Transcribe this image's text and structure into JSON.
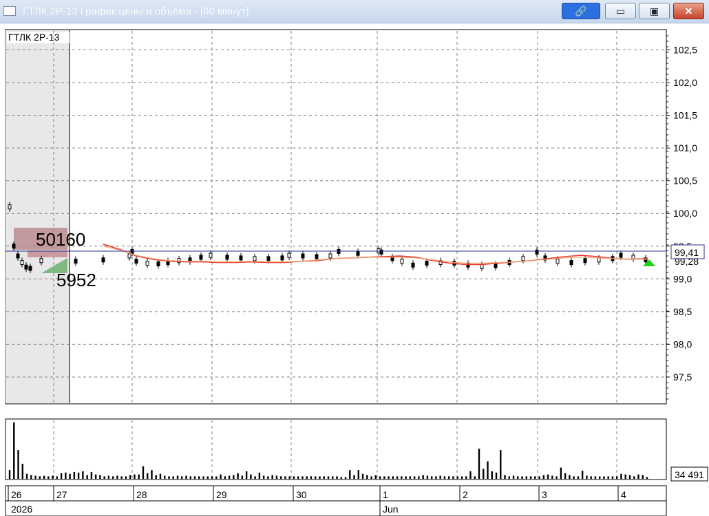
{
  "window": {
    "title": "ГТЛК 2Р-13 График цены и объёма - [60 минут]",
    "buttons": {
      "link": "🔗",
      "minimize": "▭",
      "maximize": "▣",
      "close": "✕"
    }
  },
  "chart": {
    "instrument": "ГТЛК 2Р-13",
    "big_labels": {
      "upper": "50160",
      "lower": "5952"
    }
  },
  "chart_data": [
    {
      "type": "line",
      "title": "ГТЛК 2Р-13",
      "y_ticks": [
        "102,5",
        "102,0",
        "101,5",
        "101,0",
        "100,5",
        "100,0",
        "99,5",
        "99,0",
        "98,5",
        "98,0",
        "97,5"
      ],
      "ylim": [
        97.1,
        102.8
      ],
      "last_price": "99,41",
      "prev_price": "99,28",
      "grid": true,
      "x_labels": [
        "26",
        "27",
        "28",
        "29",
        "30",
        "1",
        "2",
        "3",
        "4"
      ],
      "year_label": "2026",
      "month_label": "Jun",
      "series": [
        {
          "values": [
            99.53,
            99.45,
            99.35,
            99.3,
            99.27,
            99.26,
            99.26,
            99.25,
            99.25,
            99.26,
            99.25,
            99.25,
            99.27,
            99.28,
            99.31,
            99.32,
            99.33,
            99.34,
            99.35,
            99.33,
            99.28,
            99.24,
            99.22,
            99.22,
            99.24,
            99.26,
            99.28,
            99.31,
            99.34,
            99.36,
            99.34,
            99.31,
            99.3,
            99.31
          ]
        },
        {
          "values": [
            99.5,
            99.44,
            99.36,
            99.31,
            99.28,
            99.27,
            99.27,
            99.26,
            99.26,
            99.27,
            99.26,
            99.26,
            99.27,
            99.29,
            99.31,
            99.32,
            99.33,
            99.33,
            99.33,
            99.32,
            99.29,
            99.26,
            99.24,
            99.24,
            99.25,
            99.26,
            99.28,
            99.3,
            99.32,
            99.33,
            99.32,
            99.31,
            99.3,
            99.3
          ]
        }
      ]
    },
    {
      "type": "bar",
      "title": "",
      "last_volume": "34 491",
      "values": [
        14,
        90,
        46,
        24,
        8,
        6,
        5,
        4,
        5,
        4,
        5,
        4,
        9,
        10,
        8,
        11,
        10,
        12,
        6,
        11,
        7,
        6,
        4,
        5,
        4,
        5,
        4,
        4,
        6,
        7,
        7,
        20,
        9,
        14,
        6,
        8,
        5,
        4,
        4,
        5,
        4,
        5,
        4,
        4,
        4,
        4,
        4,
        4,
        4,
        7,
        4,
        5,
        6,
        9,
        5,
        12,
        7,
        4,
        10,
        5,
        4,
        6,
        5,
        4,
        4,
        4,
        4,
        4,
        4,
        4,
        4,
        4,
        4,
        4,
        4,
        4,
        4,
        3,
        3,
        14,
        6,
        14,
        8,
        6,
        4,
        6,
        4,
        4,
        4,
        4,
        4,
        4,
        4,
        4,
        4,
        4,
        6,
        5,
        4,
        4,
        5,
        4,
        4,
        4,
        4,
        4,
        4,
        12,
        4,
        48,
        16,
        28,
        12,
        10,
        46,
        6,
        4,
        5,
        4,
        4,
        4,
        4,
        4,
        4,
        6,
        7,
        5,
        4,
        18,
        9,
        6,
        4,
        4,
        13,
        5,
        4,
        4,
        4,
        4,
        4,
        4,
        4,
        8,
        7,
        6,
        4,
        7,
        6,
        3
      ]
    }
  ]
}
